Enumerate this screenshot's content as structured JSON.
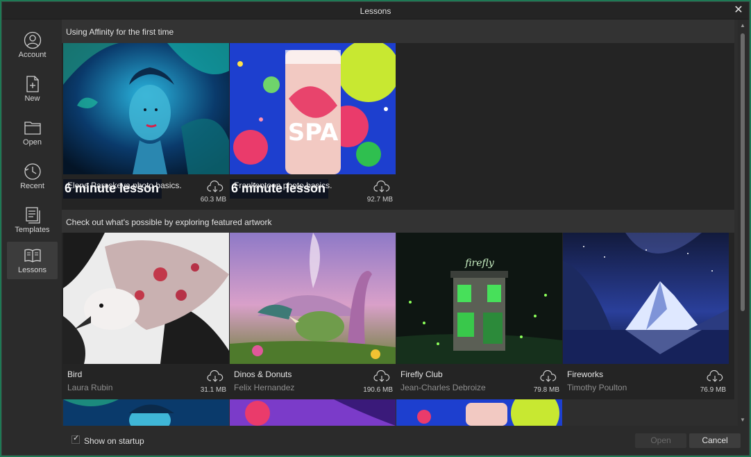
{
  "window": {
    "title": "Lessons"
  },
  "sidebar": {
    "items": [
      {
        "label": "Account",
        "icon": "account-icon"
      },
      {
        "label": "New",
        "icon": "new-document-icon"
      },
      {
        "label": "Open",
        "icon": "folder-icon"
      },
      {
        "label": "Recent",
        "icon": "clock-icon"
      },
      {
        "label": "Templates",
        "icon": "templates-icon"
      },
      {
        "label": "Lessons",
        "icon": "book-icon",
        "active": true
      }
    ]
  },
  "sections": [
    {
      "title": "Using Affinity for the first time",
      "cards": [
        {
          "badge": "6 minute lesson",
          "name": "Elena Paraskeva photo basics.",
          "size": "60.3 MB"
        },
        {
          "badge": "6 minute lesson",
          "name": "Frankentoon photo basics.",
          "size": "92.7 MB"
        }
      ]
    },
    {
      "title": "Check out what's possible by exploring featured artwork",
      "cards": [
        {
          "name": "Bird",
          "author": "Laura Rubin",
          "size": "31.1 MB"
        },
        {
          "name": "Dinos & Donuts",
          "author": "Felix Hernandez",
          "size": "190.6 MB"
        },
        {
          "name": "Firefly Club",
          "author": "Jean-Charles Debroize",
          "size": "79.8 MB"
        },
        {
          "name": "Fireworks",
          "author": "Timothy Poulton",
          "size": "76.9 MB"
        }
      ]
    }
  ],
  "footer": {
    "show_on_startup_label": "Show on startup",
    "show_on_startup_checked": true,
    "open_label": "Open",
    "cancel_label": "Cancel"
  },
  "colors": {
    "accent_border": "#1e7a55",
    "badge_bg": "#0f1420"
  }
}
